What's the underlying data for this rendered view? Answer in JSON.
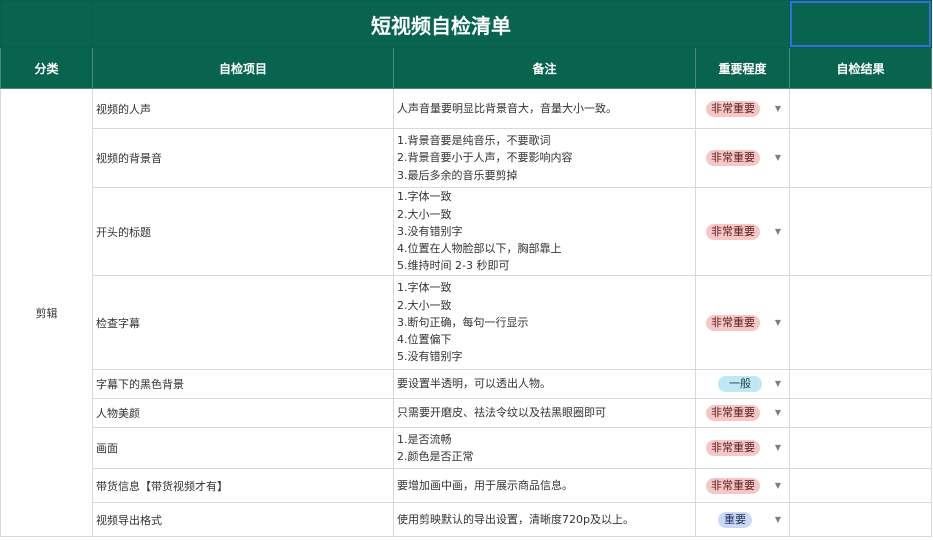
{
  "sheet": {
    "title": "短视频自检清单",
    "headers": {
      "category": "分类",
      "item": "自检项目",
      "note": "备注",
      "importance": "重要程度",
      "result": "自检结果"
    },
    "category": "剪辑",
    "rows": [
      {
        "item": "视频的人声",
        "note": [
          "人声音量要明显比背景音大，音量大小一致。"
        ],
        "level": "非常重要"
      },
      {
        "item": "视频的背景音",
        "note": [
          "1.背景音要是纯音乐，不要歌词",
          "2.背景音要小于人声，不要影响内容",
          "3.最后多余的音乐要剪掉"
        ],
        "level": "非常重要"
      },
      {
        "item": "开头的标题",
        "note": [
          "1.字体一致",
          "2.大小一致",
          "3.没有错别字",
          "4.位置在人物脸部以下，胸部靠上",
          "5.维持时间 2-3 秒即可"
        ],
        "level": "非常重要"
      },
      {
        "item": "检查字幕",
        "note": [
          "1.字体一致",
          "2.大小一致",
          "3.断句正确，每句一行显示",
          "4.位置偏下",
          "5.没有错别字"
        ],
        "level": "非常重要"
      },
      {
        "item": "字幕下的黑色背景",
        "note": [
          "要设置半透明，可以透出人物。"
        ],
        "level": "一般"
      },
      {
        "item": "人物美颜",
        "note": [
          "只需要开磨皮、祛法令纹以及祛黑眼圈即可"
        ],
        "level": "非常重要"
      },
      {
        "item": "画面",
        "note": [
          "1.是否流畅",
          "2.颜色是否正常"
        ],
        "level": "非常重要"
      },
      {
        "item": "带货信息【带货视频才有】",
        "note": [
          "要增加画中画，用于展示商品信息。"
        ],
        "level": "非常重要"
      },
      {
        "item": "视频导出格式",
        "note": [
          "使用剪映默认的导出设置，清晰度720p及以上。"
        ],
        "level": "重要"
      }
    ]
  },
  "colors": {
    "header_bg": "#08644f",
    "selection": "#2f6fe0",
    "very_important": "#f7c7c8",
    "normal": "#bfe8f4",
    "important": "#c9d9f7"
  }
}
